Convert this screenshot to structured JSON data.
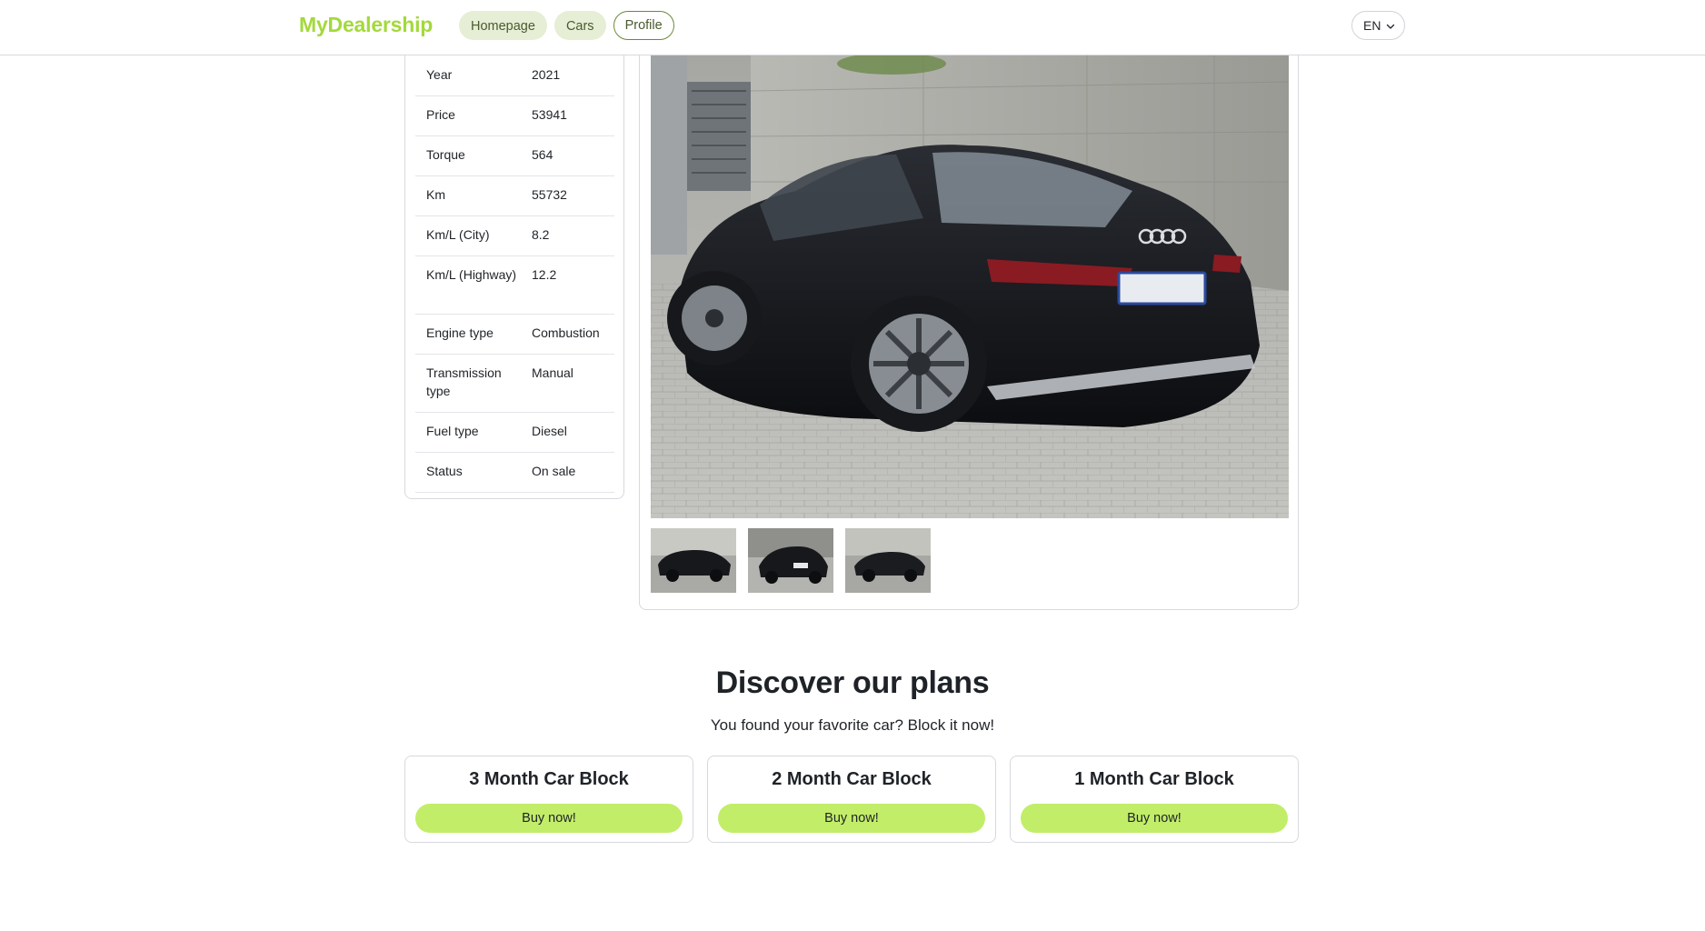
{
  "header": {
    "logo": "MyDealership",
    "nav": [
      {
        "label": "Homepage"
      },
      {
        "label": "Cars"
      },
      {
        "label": "Profile"
      }
    ],
    "language": "EN",
    "colors": {
      "brand": "#a3d93b",
      "pill_bg": "#e6eed6"
    }
  },
  "specs": [
    {
      "label": "Year",
      "value": "2021"
    },
    {
      "label": "Price",
      "value": "53941"
    },
    {
      "label": "Torque",
      "value": "564"
    },
    {
      "label": "Km",
      "value": "55732"
    },
    {
      "label": "Km/L (City)",
      "value": "8.2"
    },
    {
      "label": "Km/L (Highway)",
      "value": "12.2"
    },
    {
      "label": "Engine type",
      "value": "Combustion"
    },
    {
      "label": "Transmission type",
      "value": "Manual"
    },
    {
      "label": "Fuel type",
      "value": "Diesel"
    },
    {
      "label": "Status",
      "value": "On sale"
    }
  ],
  "gallery": {
    "main_image": "black-audi-a5-sportback-rear-view",
    "thumbnails": [
      "car-front-view",
      "car-rear-view",
      "car-side-rear-view"
    ]
  },
  "plans": {
    "title": "Discover our plans",
    "subtitle": "You found your favorite car? Block it now!",
    "items": [
      {
        "name": "3 Month Car Block",
        "button": "Buy now!"
      },
      {
        "name": "2 Month Car Block",
        "button": "Buy now!"
      },
      {
        "name": "1 Month Car Block",
        "button": "Buy now!"
      }
    ],
    "button_color": "#c2ed69"
  }
}
